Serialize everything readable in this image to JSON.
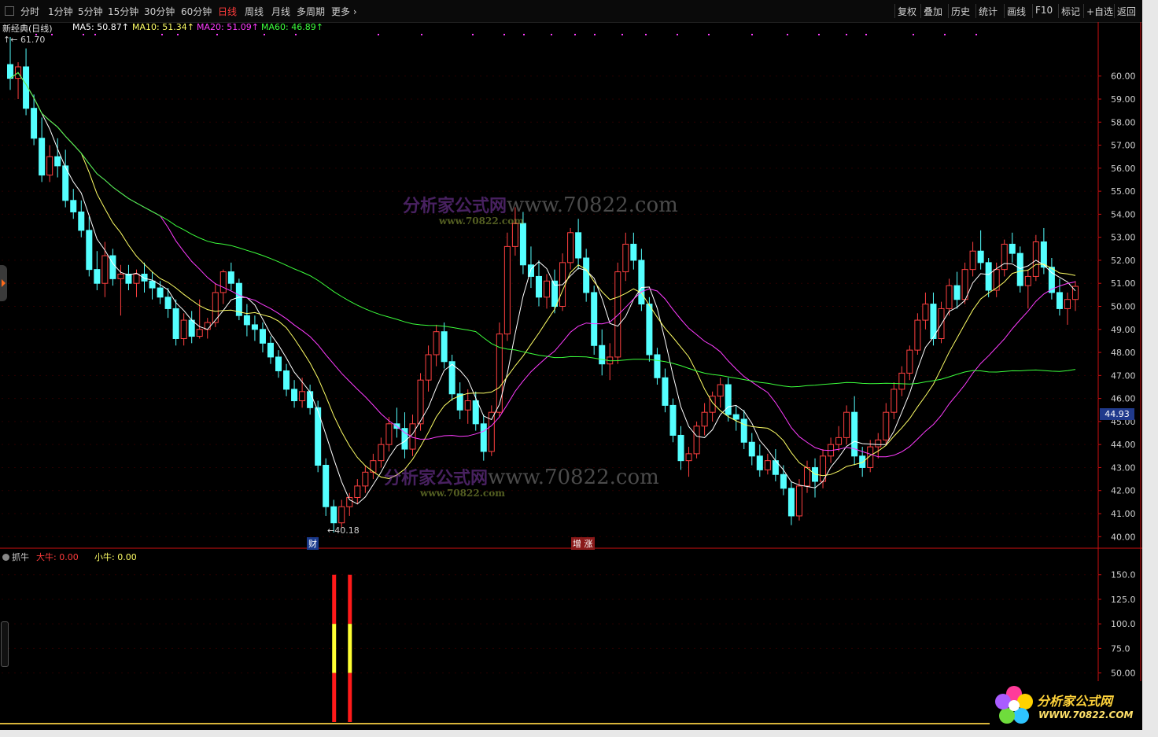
{
  "toolbar": {
    "period_tabs": [
      "分时",
      "1分钟",
      "5分钟",
      "15分钟",
      "30分钟",
      "60分钟",
      "日线",
      "周线",
      "月线",
      "多周期",
      "更多 ›"
    ],
    "active_tab": "日线",
    "right_buttons": [
      "复权",
      "叠加",
      "历史",
      "统计",
      "画线",
      "F10",
      "标记",
      "+自选",
      "返回"
    ]
  },
  "main_chart": {
    "title": "新经典(日线)",
    "ma5": "MA5: 50.87↑",
    "ma10": "MA10: 51.34↑",
    "ma20": "MA20: 51.09↑",
    "ma60": "MA60: 46.89↑",
    "high_label": "61.70",
    "low_label": "40.18",
    "current_price": "44.93",
    "markers": [
      "财",
      "增 涨"
    ],
    "colors": {
      "up": "#ff4040",
      "down": "#54ffff",
      "ma5": "#ffffff",
      "ma10": "#ffff66",
      "ma20": "#ff3cff",
      "ma60": "#3cff3c",
      "axis": "#d01010"
    }
  },
  "sub_chart": {
    "title": "抓牛",
    "big_bull": "大牛: 0.00",
    "small_bull": "小牛: 0.00"
  },
  "watermark": {
    "site": "分析家公式网",
    "url": "www.70822.com",
    "sub_url": "www.70822.com",
    "logo_url": "WWW.70822.COM"
  },
  "chart_data": {
    "type": "candlestick",
    "price_axis": {
      "ticks": [
        "60.00",
        "59.00",
        "58.00",
        "57.00",
        "56.00",
        "55.00",
        "54.00",
        "53.00",
        "52.00",
        "51.00",
        "50.00",
        "49.00",
        "48.00",
        "47.00",
        "46.00",
        "45.00",
        "44.00",
        "43.00",
        "42.00",
        "41.00",
        "40.00"
      ],
      "ylim": [
        39.6,
        61.8
      ]
    },
    "indicator_axis": {
      "ticks": [
        "150.0",
        "125.0",
        "100.0",
        "75.0",
        "50.00"
      ],
      "ylim": [
        0,
        165
      ]
    },
    "candles": [
      [
        60.5,
        61.7,
        59.4,
        59.9
      ],
      [
        59.9,
        60.6,
        59.0,
        60.4
      ],
      [
        60.4,
        61.2,
        58.3,
        58.6
      ],
      [
        58.6,
        59.2,
        57.0,
        57.3
      ],
      [
        57.3,
        58.2,
        55.4,
        55.7
      ],
      [
        55.7,
        57.0,
        55.4,
        56.5
      ],
      [
        56.5,
        57.3,
        55.6,
        56.1
      ],
      [
        56.1,
        56.8,
        54.3,
        54.6
      ],
      [
        54.6,
        55.1,
        53.8,
        54.1
      ],
      [
        54.1,
        54.6,
        53.0,
        53.3
      ],
      [
        53.3,
        53.9,
        51.3,
        51.6
      ],
      [
        51.6,
        52.4,
        50.7,
        51.0
      ],
      [
        51.0,
        52.8,
        50.4,
        52.2
      ],
      [
        52.2,
        52.5,
        50.9,
        51.2
      ],
      [
        51.2,
        51.8,
        49.6,
        51.4
      ],
      [
        51.4,
        51.8,
        50.7,
        51.0
      ],
      [
        51.0,
        51.6,
        50.4,
        51.4
      ],
      [
        51.4,
        51.9,
        50.6,
        51.1
      ],
      [
        51.1,
        51.5,
        50.3,
        50.8
      ],
      [
        50.8,
        51.1,
        50.1,
        50.4
      ],
      [
        50.4,
        50.8,
        49.5,
        49.9
      ],
      [
        49.9,
        50.3,
        48.3,
        48.6
      ],
      [
        48.6,
        49.7,
        48.3,
        49.4
      ],
      [
        49.4,
        49.8,
        48.4,
        48.7
      ],
      [
        48.7,
        50.3,
        48.6,
        49.0
      ],
      [
        49.0,
        49.5,
        48.6,
        49.3
      ],
      [
        49.3,
        51.0,
        49.1,
        50.6
      ],
      [
        50.6,
        51.6,
        50.1,
        51.5
      ],
      [
        51.5,
        51.9,
        50.7,
        51.0
      ],
      [
        51.0,
        51.2,
        49.4,
        49.6
      ],
      [
        49.6,
        50.1,
        48.7,
        49.2
      ],
      [
        49.2,
        49.6,
        48.5,
        49.0
      ],
      [
        49.0,
        49.3,
        48.0,
        48.4
      ],
      [
        48.4,
        48.7,
        47.5,
        47.8
      ],
      [
        47.8,
        48.1,
        46.9,
        47.2
      ],
      [
        47.2,
        47.5,
        46.1,
        46.4
      ],
      [
        46.4,
        46.8,
        45.6,
        45.9
      ],
      [
        45.9,
        46.9,
        45.6,
        46.3
      ],
      [
        46.3,
        46.6,
        45.3,
        45.6
      ],
      [
        45.6,
        45.9,
        42.8,
        43.1
      ],
      [
        43.1,
        43.4,
        40.9,
        41.3
      ],
      [
        41.3,
        41.6,
        40.18,
        40.6
      ],
      [
        40.6,
        41.6,
        40.4,
        41.3
      ],
      [
        41.3,
        41.9,
        40.9,
        41.7
      ],
      [
        41.7,
        42.5,
        41.4,
        42.2
      ],
      [
        42.2,
        43.1,
        41.9,
        42.8
      ],
      [
        42.8,
        43.6,
        42.5,
        43.3
      ],
      [
        43.3,
        44.3,
        43.0,
        44.0
      ],
      [
        44.0,
        45.2,
        43.7,
        44.9
      ],
      [
        44.9,
        45.6,
        44.3,
        44.7
      ],
      [
        44.7,
        45.4,
        43.4,
        43.8
      ],
      [
        43.8,
        45.3,
        43.5,
        44.9
      ],
      [
        44.9,
        47.1,
        44.6,
        46.8
      ],
      [
        46.8,
        48.3,
        46.3,
        47.9
      ],
      [
        47.9,
        49.2,
        47.4,
        48.9
      ],
      [
        48.9,
        49.3,
        47.3,
        47.6
      ],
      [
        47.6,
        47.9,
        45.9,
        46.2
      ],
      [
        46.2,
        46.7,
        45.1,
        45.5
      ],
      [
        45.5,
        46.4,
        44.9,
        45.9
      ],
      [
        45.9,
        46.3,
        44.6,
        44.9
      ],
      [
        44.9,
        45.3,
        43.3,
        43.7
      ],
      [
        43.7,
        45.7,
        43.5,
        45.4
      ],
      [
        45.4,
        49.3,
        45.2,
        48.8
      ],
      [
        48.8,
        53.2,
        48.5,
        52.6
      ],
      [
        52.6,
        54.3,
        52.2,
        53.6
      ],
      [
        53.6,
        54.1,
        51.4,
        51.8
      ],
      [
        51.8,
        52.6,
        50.8,
        51.3
      ],
      [
        51.3,
        52.0,
        50.0,
        50.4
      ],
      [
        50.4,
        51.4,
        49.9,
        51.1
      ],
      [
        51.1,
        51.6,
        49.7,
        50.0
      ],
      [
        50.0,
        52.3,
        49.8,
        51.9
      ],
      [
        51.9,
        53.4,
        51.6,
        53.2
      ],
      [
        53.2,
        53.8,
        51.6,
        52.1
      ],
      [
        52.1,
        52.5,
        50.2,
        50.6
      ],
      [
        50.6,
        50.9,
        47.9,
        48.3
      ],
      [
        48.3,
        49.0,
        47.0,
        47.5
      ],
      [
        47.5,
        48.4,
        46.8,
        47.8
      ],
      [
        47.8,
        51.9,
        47.5,
        51.5
      ],
      [
        51.5,
        53.2,
        51.1,
        52.7
      ],
      [
        52.7,
        53.2,
        51.6,
        52.0
      ],
      [
        52.0,
        52.5,
        49.8,
        50.1
      ],
      [
        50.1,
        50.4,
        47.6,
        47.9
      ],
      [
        47.9,
        48.2,
        46.6,
        46.9
      ],
      [
        46.9,
        47.3,
        45.4,
        45.7
      ],
      [
        45.7,
        46.0,
        44.1,
        44.4
      ],
      [
        44.4,
        44.8,
        42.9,
        43.3
      ],
      [
        43.3,
        43.9,
        42.6,
        43.6
      ],
      [
        43.6,
        45.0,
        43.4,
        44.8
      ],
      [
        44.8,
        45.8,
        44.4,
        45.4
      ],
      [
        45.4,
        46.3,
        45.0,
        46.1
      ],
      [
        46.1,
        46.9,
        45.6,
        46.6
      ],
      [
        46.6,
        46.9,
        45.0,
        45.3
      ],
      [
        45.3,
        45.7,
        44.6,
        45.1
      ],
      [
        45.1,
        45.5,
        43.8,
        44.1
      ],
      [
        44.1,
        44.5,
        43.1,
        43.5
      ],
      [
        43.5,
        44.0,
        42.6,
        42.9
      ],
      [
        42.9,
        43.6,
        42.7,
        43.3
      ],
      [
        43.3,
        43.8,
        42.4,
        42.7
      ],
      [
        42.7,
        43.1,
        41.8,
        42.1
      ],
      [
        42.1,
        42.4,
        40.5,
        40.9
      ],
      [
        40.9,
        42.5,
        40.7,
        42.2
      ],
      [
        42.2,
        43.3,
        41.9,
        43.0
      ],
      [
        43.0,
        43.4,
        41.7,
        42.4
      ],
      [
        42.4,
        43.8,
        42.1,
        43.5
      ],
      [
        43.5,
        44.3,
        43.2,
        44.0
      ],
      [
        44.0,
        44.8,
        43.7,
        44.3
      ],
      [
        44.3,
        45.7,
        44.0,
        45.4
      ],
      [
        45.4,
        46.1,
        43.1,
        43.5
      ],
      [
        43.5,
        43.9,
        42.6,
        43.0
      ],
      [
        43.0,
        44.2,
        42.8,
        43.9
      ],
      [
        43.9,
        44.5,
        43.4,
        44.2
      ],
      [
        44.2,
        45.8,
        44.0,
        45.4
      ],
      [
        45.4,
        46.7,
        45.1,
        46.4
      ],
      [
        46.4,
        47.4,
        46.1,
        47.1
      ],
      [
        47.1,
        48.3,
        46.8,
        48.1
      ],
      [
        48.1,
        49.7,
        47.9,
        49.4
      ],
      [
        49.4,
        50.6,
        49.0,
        50.1
      ],
      [
        50.1,
        50.6,
        48.3,
        48.6
      ],
      [
        48.6,
        50.2,
        48.4,
        49.9
      ],
      [
        49.9,
        51.2,
        49.6,
        50.9
      ],
      [
        50.9,
        51.5,
        49.9,
        50.3
      ],
      [
        50.3,
        51.9,
        50.1,
        51.6
      ],
      [
        51.6,
        52.8,
        51.3,
        52.4
      ],
      [
        52.4,
        53.3,
        51.6,
        51.9
      ],
      [
        51.9,
        52.1,
        50.4,
        50.7
      ],
      [
        50.7,
        51.9,
        50.4,
        51.6
      ],
      [
        51.6,
        52.9,
        51.3,
        52.7
      ],
      [
        52.7,
        53.2,
        51.9,
        52.3
      ],
      [
        52.3,
        52.6,
        50.6,
        50.9
      ],
      [
        50.9,
        51.6,
        49.9,
        51.3
      ],
      [
        51.3,
        53.1,
        51.1,
        52.8
      ],
      [
        52.8,
        53.4,
        51.4,
        51.7
      ],
      [
        51.7,
        52.1,
        50.3,
        50.6
      ],
      [
        50.6,
        51.2,
        49.6,
        49.9
      ],
      [
        49.9,
        50.6,
        49.2,
        50.3
      ],
      [
        50.3,
        51.1,
        49.8,
        50.87
      ]
    ],
    "signal_bars": [
      {
        "index": 41,
        "value": 150
      },
      {
        "index": 43,
        "value": 150
      }
    ]
  }
}
